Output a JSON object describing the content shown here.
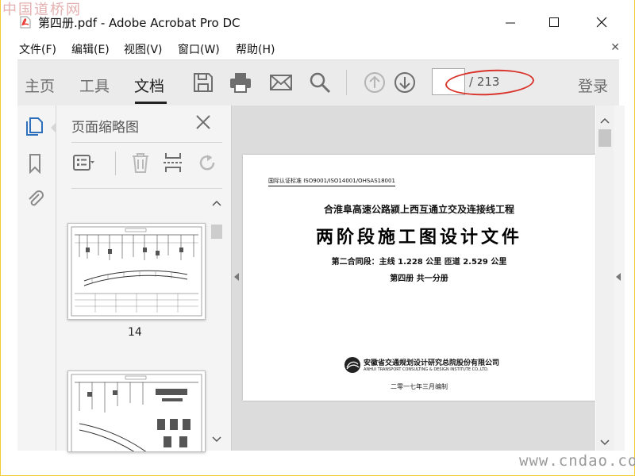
{
  "watermark_top": "中国道桥网",
  "watermark_bottom": "www.cndao.com",
  "window": {
    "title": "第四册.pdf - Adobe Acrobat Pro DC"
  },
  "menu": [
    "文件(F)",
    "编辑(E)",
    "视图(V)",
    "窗口(W)",
    "帮助(H)"
  ],
  "toolbar": {
    "tabs": [
      "主页",
      "工具",
      "文档"
    ],
    "active_tab": "文档",
    "page_total": "/ 213",
    "page_current": "",
    "login": "登录"
  },
  "thumbnails": {
    "title": "页面缩略图",
    "pages": [
      {
        "label": "14"
      },
      {
        "label": ""
      }
    ]
  },
  "document": {
    "cert_line": "国际认证标准 ISO9001/ISO14001/OHSAS18001",
    "project": "合淮阜高速公路颍上西互通立交及连接线工程",
    "main_title": "两阶段施工图设计文件",
    "section": "第二合同段：主线 1.228 公里 匝道 2.529 公里",
    "volume": "第四册 共一分册",
    "institute_cn": "安徽省交通规划设计研究总院股份有限公司",
    "institute_en": "ANHUI TRANSPORT CONSULTING & DESIGN INSTITUTE CO.,LTD.",
    "date": "二零一七年三月编制"
  },
  "colors": {
    "accent_red": "#d9342b",
    "toolbar_bg": "#ebebeb",
    "icon_blue": "#2d6fba"
  }
}
